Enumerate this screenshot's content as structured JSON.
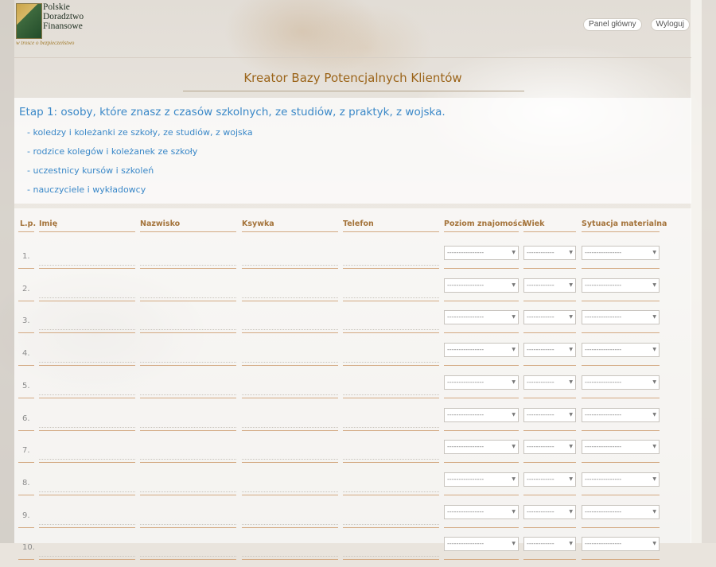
{
  "brand": {
    "name_lines": [
      "Polskie",
      "Doradztwo",
      "Finansowe"
    ],
    "tagline": "w trosce o bezpieczeństwo"
  },
  "nav": {
    "home_label": "Panel główny",
    "logout_label": "Wyloguj"
  },
  "page_title": "Kreator Bazy Potencjalnych Klientów",
  "step": {
    "heading": "Etap 1: osoby, które znasz z czasów szkolnych, ze studiów, z praktyk, z wojska.",
    "bullets": [
      "- koledzy i koleżanki ze szkoły, ze studiów, z wojska",
      "- rodzice kolegów i koleżanek ze szkoły",
      "- uczestnicy kursów i szkoleń",
      "- nauczyciele i wykładowcy"
    ]
  },
  "table": {
    "headers": {
      "lp": "L.p.",
      "imie": "Imię",
      "nazwisko": "Nazwisko",
      "ksywka": "Ksywka",
      "telefon": "Telefon",
      "poziom": "Poziom znajomości",
      "wiek": "Wiek",
      "sytuacja": "Sytuacja materialna"
    },
    "select_placeholder": "----------------",
    "select_placeholder_short": "------------",
    "rows": [
      "1.",
      "2.",
      "3.",
      "4.",
      "5.",
      "6.",
      "7.",
      "8.",
      "9.",
      "10."
    ]
  },
  "colors": {
    "title": "#9b6419",
    "step_blue": "#3a88c8",
    "header_brown": "#a4733a",
    "rule": "#d3a982"
  }
}
